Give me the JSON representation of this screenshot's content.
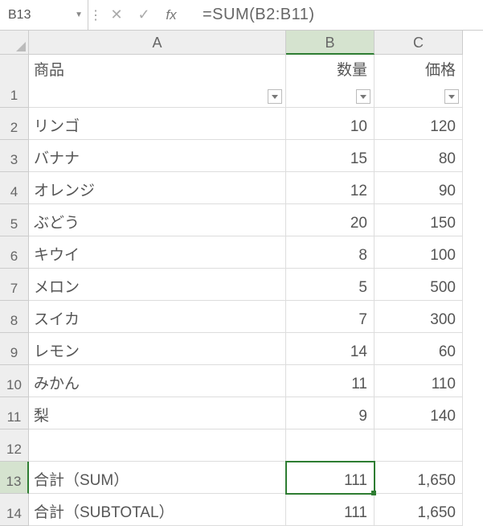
{
  "chart_data": {
    "type": "table",
    "columns": [
      "商品",
      "数量",
      "価格"
    ],
    "rows": [
      [
        "リンゴ",
        10,
        120
      ],
      [
        "バナナ",
        15,
        80
      ],
      [
        "オレンジ",
        12,
        90
      ],
      [
        "ぶどう",
        20,
        150
      ],
      [
        "キウイ",
        8,
        100
      ],
      [
        "メロン",
        5,
        500
      ],
      [
        "スイカ",
        7,
        300
      ],
      [
        "レモン",
        14,
        60
      ],
      [
        "みかん",
        11,
        110
      ],
      [
        "梨",
        9,
        140
      ]
    ],
    "totals": {
      "合計（SUM）": {
        "数量": 111,
        "価格": "1,650"
      },
      "合計（SUBTOTAL）": {
        "数量": 111,
        "価格": "1,650"
      }
    }
  },
  "namebox": "B13",
  "formula": "=SUM(B2:B11)",
  "cols": {
    "A": "A",
    "B": "B",
    "C": "C"
  },
  "h": {
    "A": "商品",
    "B": "数量",
    "C": "価格"
  },
  "r2": {
    "A": "リンゴ",
    "B": "10",
    "C": "120"
  },
  "r3": {
    "A": "バナナ",
    "B": "15",
    "C": "80"
  },
  "r4": {
    "A": "オレンジ",
    "B": "12",
    "C": "90"
  },
  "r5": {
    "A": "ぶどう",
    "B": "20",
    "C": "150"
  },
  "r6": {
    "A": "キウイ",
    "B": "8",
    "C": "100"
  },
  "r7": {
    "A": "メロン",
    "B": "5",
    "C": "500"
  },
  "r8": {
    "A": "スイカ",
    "B": "7",
    "C": "300"
  },
  "r9": {
    "A": "レモン",
    "B": "14",
    "C": "60"
  },
  "r10": {
    "A": "みかん",
    "B": "11",
    "C": "110"
  },
  "r11": {
    "A": "梨",
    "B": "9",
    "C": "140"
  },
  "r12": {
    "A": "",
    "B": "",
    "C": ""
  },
  "r13": {
    "A": "合計（SUM）",
    "B": "111",
    "C": "1,650"
  },
  "r14": {
    "A": "合計（SUBTOTAL）",
    "B": "111",
    "C": "1,650"
  },
  "rn": {
    "1": "1",
    "2": "2",
    "3": "3",
    "4": "4",
    "5": "5",
    "6": "6",
    "7": "7",
    "8": "8",
    "9": "9",
    "10": "10",
    "11": "11",
    "12": "12",
    "13": "13",
    "14": "14"
  }
}
